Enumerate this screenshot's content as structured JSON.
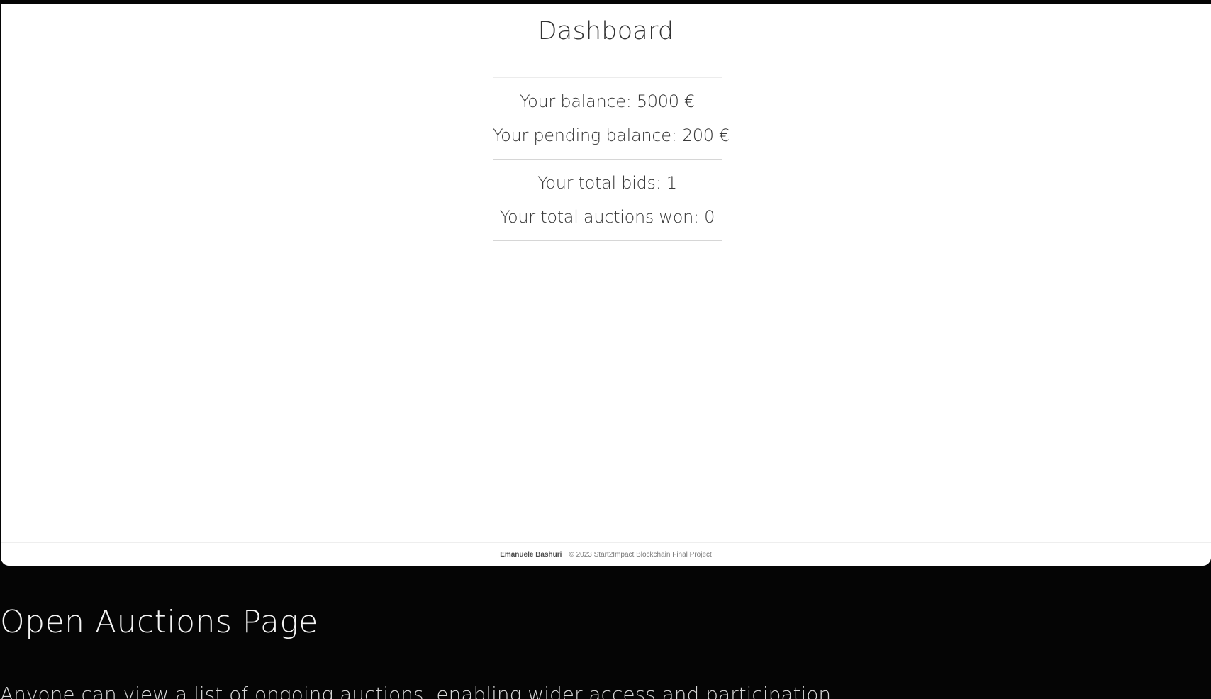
{
  "dashboard": {
    "title": "Dashboard",
    "balance": "Your balance: 5000 €",
    "pending_balance": "Your pending balance: 200 €",
    "total_bids": "Your total bids: 1",
    "total_auctions_won": "Your total auctions won: 0"
  },
  "footer": {
    "author": "Emanuele Bashuri",
    "copyright": "© 2023 Start2Impact Blockchain Final Project"
  },
  "section": {
    "heading": "Open Auctions Page",
    "description": "Anyone can view a list of ongoing auctions, enabling wider access and participation."
  },
  "colors": {
    "page_background": "#050505",
    "panel_background": "#ffffff",
    "text_dark": "#333333",
    "text_light": "#f4f4f4"
  }
}
